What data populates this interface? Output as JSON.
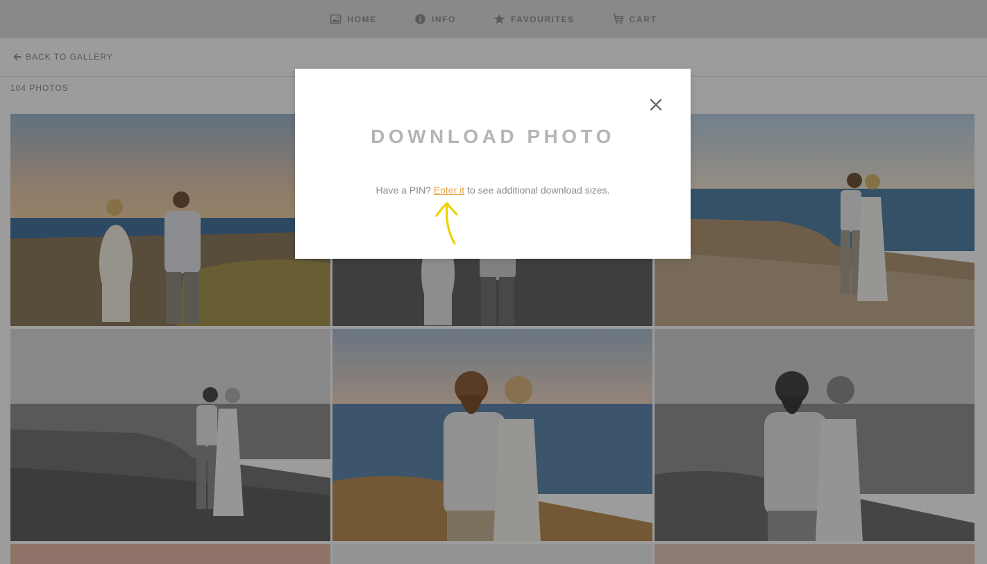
{
  "nav": {
    "items": [
      {
        "label": "HOME",
        "icon": "home-image-icon"
      },
      {
        "label": "INFO",
        "icon": "info-icon"
      },
      {
        "label": "FAVOURITES",
        "icon": "star-icon"
      },
      {
        "label": "CART",
        "icon": "cart-icon"
      }
    ]
  },
  "subheader": {
    "back_label": "BACK TO GALLERY",
    "photo_count": "104 PHOTOS"
  },
  "gallery": {
    "tiles": [
      {
        "kind": "couple walking away on clifftop at sunset",
        "tone": "color"
      },
      {
        "kind": "couple walking away on clifftop",
        "tone": "bw"
      },
      {
        "kind": "couple kissing on cliff edge",
        "tone": "color"
      },
      {
        "kind": "couple kissing on cliff edge",
        "tone": "bw"
      },
      {
        "kind": "couple portrait by the sea",
        "tone": "color"
      },
      {
        "kind": "couple portrait by the sea",
        "tone": "bw"
      }
    ]
  },
  "modal": {
    "title": "DOWNLOAD PHOTO",
    "text_before": "Have a PIN?",
    "link_text": "Enter it",
    "text_after": "to see additional download sizes.",
    "close_icon": "close-icon",
    "annotation": "hand-drawn-arrow",
    "accent_color": "#e4a64a",
    "arrow_color": "#f0d200"
  }
}
